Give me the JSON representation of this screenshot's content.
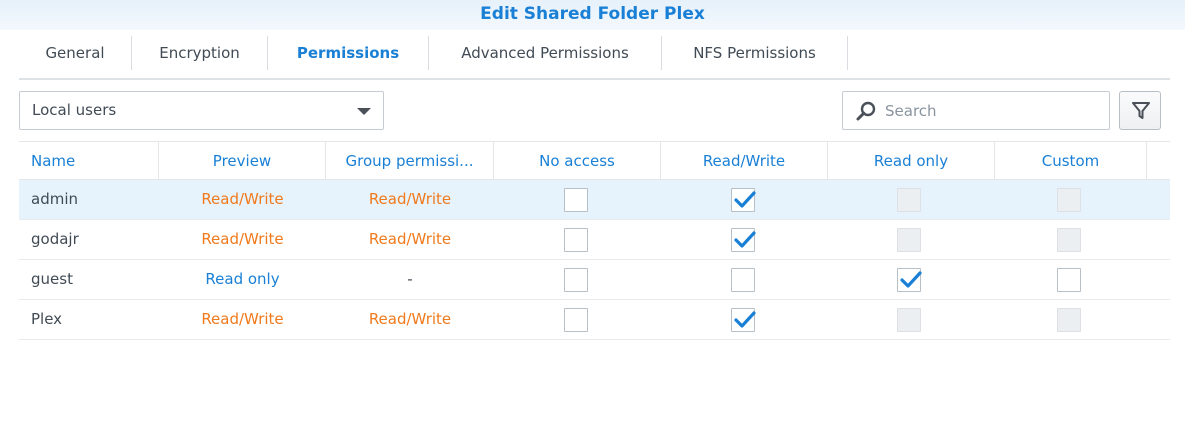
{
  "window": {
    "title": "Edit Shared Folder Plex"
  },
  "tabs": [
    {
      "label": "General",
      "active": false
    },
    {
      "label": "Encryption",
      "active": false
    },
    {
      "label": "Permissions",
      "active": true
    },
    {
      "label": "Advanced Permissions",
      "active": false
    },
    {
      "label": "NFS Permissions",
      "active": false
    }
  ],
  "user_filter": {
    "selected": "Local users"
  },
  "search": {
    "placeholder": "Search",
    "value": ""
  },
  "filter_button": {
    "icon": "filter-icon"
  },
  "columns": {
    "name": "Name",
    "preview": "Preview",
    "group_permission": "Group permissi...",
    "no_access": "No access",
    "read_write": "Read/Write",
    "read_only": "Read only",
    "custom": "Custom"
  },
  "rows": [
    {
      "name": "admin",
      "preview": "Read/Write",
      "group": "Read/Write",
      "no_access": false,
      "read_write": true,
      "read_only": false,
      "custom": false,
      "selected": true,
      "read_only_enabled": false,
      "custom_enabled": false
    },
    {
      "name": "godajr",
      "preview": "Read/Write",
      "group": "Read/Write",
      "no_access": false,
      "read_write": true,
      "read_only": false,
      "custom": false,
      "selected": false,
      "read_only_enabled": false,
      "custom_enabled": false
    },
    {
      "name": "guest",
      "preview": "Read only",
      "group": "-",
      "no_access": false,
      "read_write": false,
      "read_only": true,
      "custom": false,
      "selected": false,
      "read_only_enabled": true,
      "custom_enabled": true
    },
    {
      "name": "Plex",
      "preview": "Read/Write",
      "group": "Read/Write",
      "no_access": false,
      "read_write": true,
      "read_only": false,
      "custom": false,
      "selected": false,
      "read_only_enabled": false,
      "custom_enabled": false
    }
  ],
  "colors": {
    "accent": "#1a80d6",
    "read_write": "#f07a1c",
    "selected_row": "#e6f2fc"
  }
}
